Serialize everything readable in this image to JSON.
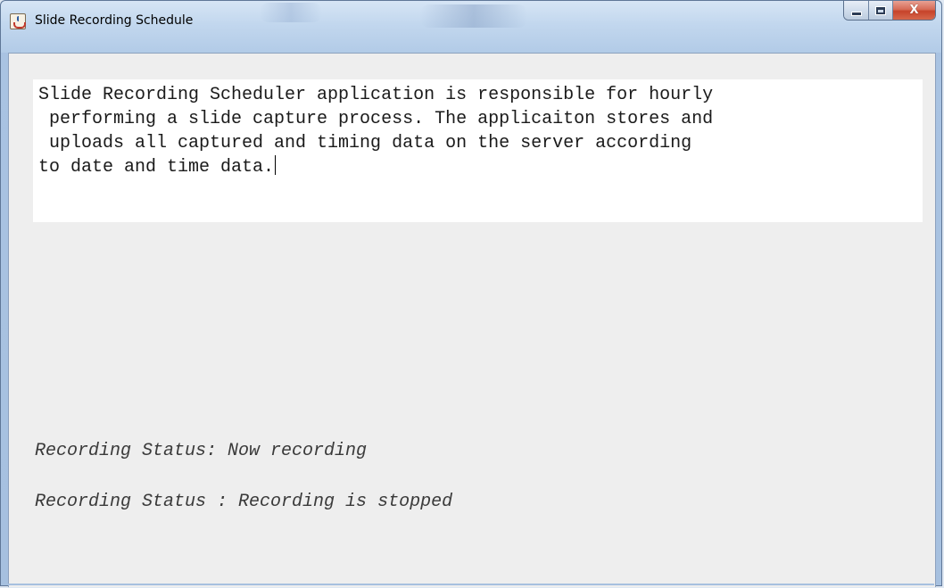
{
  "window": {
    "title": "Slide Recording Schedule",
    "controls": {
      "minimize_icon": "minimize-icon",
      "maximize_icon": "maximize-icon",
      "close_icon": "close-icon",
      "close_glyph": "X"
    },
    "app_icon": "java-cup-icon"
  },
  "main": {
    "description_lines": [
      "Slide Recording Scheduler application is responsible for hourly",
      " performing a slide capture process. The applicaiton stores and",
      " uploads all captured and timing data on the server according",
      "to date and time data."
    ],
    "status": {
      "line1": "Recording Status: Now recording",
      "line2": "Recording Status : Recording is stopped"
    }
  },
  "colors": {
    "client_background": "#eeeeee",
    "text_area_background": "#ffffff",
    "close_button": "#c7432a",
    "title_bar": "#c2d7ee"
  }
}
